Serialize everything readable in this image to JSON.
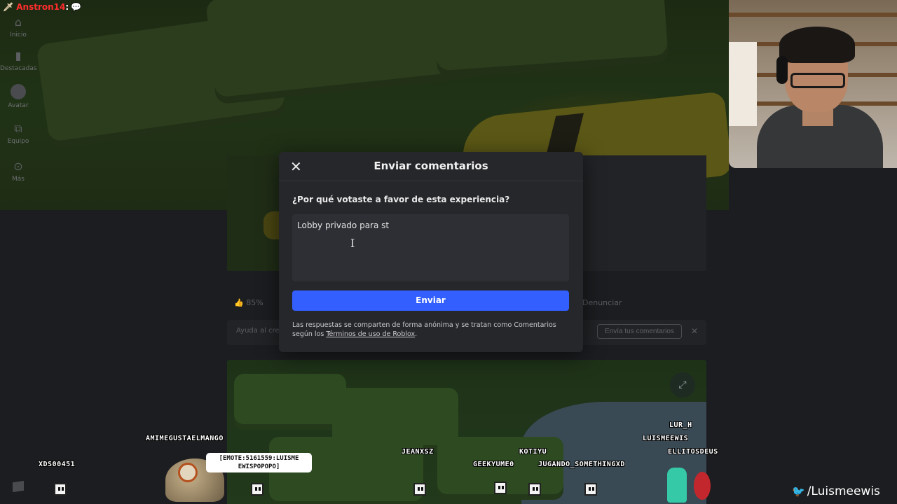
{
  "sidebar": {
    "items": [
      {
        "label": "Inicio",
        "icon": "home-icon"
      },
      {
        "label": "Destacadas",
        "icon": "bar-chart-icon"
      },
      {
        "label": "Avatar",
        "icon": "avatar-icon"
      },
      {
        "label": "Equipo",
        "icon": "team-icon"
      },
      {
        "label": "Más",
        "icon": "more-icon"
      }
    ]
  },
  "experience": {
    "vote_percent": "85%",
    "report_label": "Denunciar",
    "feedback_help": "Ayuda al crea",
    "send_feedback_label": "Envía tus comentarios"
  },
  "modal": {
    "title": "Enviar comentarios",
    "question": "¿Por qué votaste a favor de esta experiencia?",
    "answer_value": "Lobby privado para st",
    "submit_label": "Enviar",
    "disclaimer_text": "Las respuestas se comparten de forma anónima y se tratan como Comentarios según los ",
    "terms_link": "Términos de uso de Roblox",
    "disclaimer_end": "."
  },
  "overlay": {
    "chat": {
      "user": "Anstron14",
      "separator": ":"
    },
    "twitter_handle": "/Luismeewis",
    "emote_text": "[EMOTE:5161559:LUISME EWISPOPOPO]",
    "viewers": [
      "XDS00451",
      "AMIMEGUSTAELMANGO",
      "JEANXSZ",
      "KOTIYU",
      "GEEKYUME0",
      "JUGANDO_SOMETHINGXD",
      "LUR_H",
      "LUISMEEWIS",
      "ELLITOSDEUS"
    ]
  },
  "colors": {
    "primary_button": "#335fff",
    "modal_bg": "#26272b",
    "chat_user": "#ff2d2d"
  }
}
